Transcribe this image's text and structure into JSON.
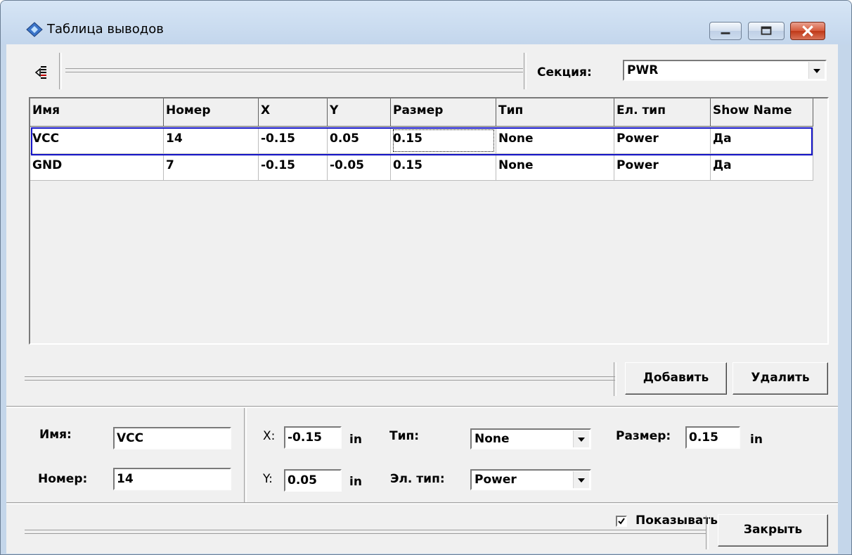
{
  "window": {
    "title": "Таблица выводов"
  },
  "toolbar": {
    "section_label": "Секция:",
    "section_value": "PWR"
  },
  "table": {
    "columns": [
      "Имя",
      "Номер",
      "X",
      "Y",
      "Размер",
      "Тип",
      "Ел. тип",
      "Show Name"
    ],
    "rows": [
      [
        "VCC",
        "14",
        "-0.15",
        "0.05",
        "0.15",
        "None",
        "Power",
        "Да"
      ],
      [
        "GND",
        "7",
        "-0.15",
        "-0.05",
        "0.15",
        "None",
        "Power",
        "Да"
      ]
    ],
    "selected_row": 0
  },
  "actions": {
    "add_label": "Добавить",
    "delete_label": "Удалить"
  },
  "props": {
    "name_label": "Имя:",
    "name_value": "VCC",
    "number_label": "Номер:",
    "number_value": "14",
    "x_label": "X:",
    "x_value": "-0.15",
    "x_unit": "in",
    "y_label": "Y:",
    "y_value": "0.05",
    "y_unit": "in",
    "type_label": "Тип:",
    "type_value": "None",
    "eltype_label": "Эл. тип:",
    "eltype_value": "Power",
    "size_label": "Размер:",
    "size_value": "0.15",
    "size_unit": "in",
    "show_name_label": "Показывать имя",
    "show_name_checked": true
  },
  "footer": {
    "close_label": "Закрыть"
  },
  "colors": {
    "selection_border": "#1414c8",
    "title_bar": "#c4d6ea",
    "close_button": "#c8462a"
  }
}
